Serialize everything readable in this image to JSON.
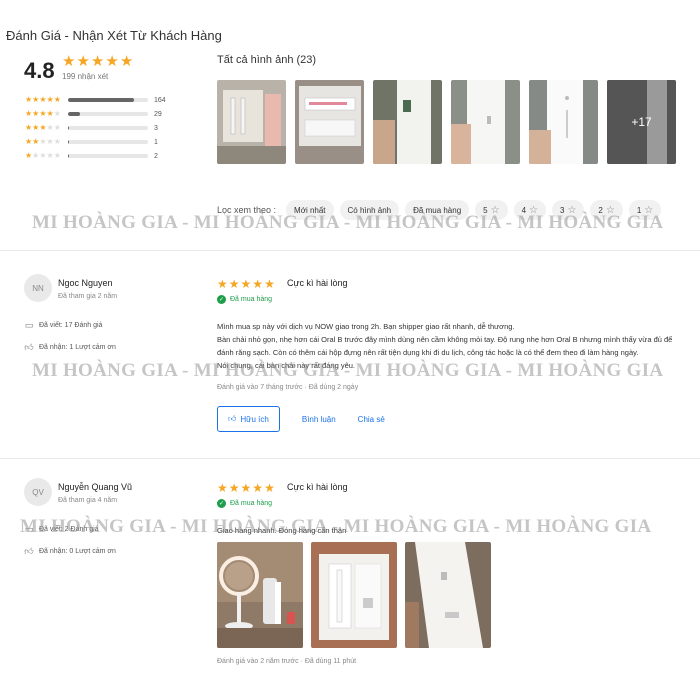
{
  "header": {
    "title": "Đánh Giá - Nhận Xét Từ Khách Hàng"
  },
  "summary": {
    "score": "4.8",
    "review_count": "199 nhận xét",
    "distribution": [
      {
        "stars": 5,
        "count": "164",
        "fraction": 0.824
      },
      {
        "stars": 4,
        "count": "29",
        "fraction": 0.146
      },
      {
        "stars": 3,
        "count": "3",
        "fraction": 0.015
      },
      {
        "stars": 2,
        "count": "1",
        "fraction": 0.005
      },
      {
        "stars": 1,
        "count": "2",
        "fraction": 0.01
      }
    ]
  },
  "gallery": {
    "title": "Tất cả hình ảnh (23)",
    "more_label": "+17"
  },
  "filters": {
    "label": "Lọc xem theo :",
    "chips": [
      "Mới nhất",
      "Có hình ảnh",
      "Đã mua hàng",
      "5",
      "4",
      "3",
      "2",
      "1"
    ]
  },
  "watermark": "MI HOÀNG GIA - MI HOÀNG GIA - MI HOÀNG GIA - MI HOÀNG GIA",
  "reviews": [
    {
      "avatar": "NN",
      "name": "Ngoc Nguyen",
      "joined": "Đã tham gia 2 năm",
      "written": "Đã viết: 17 Đánh giá",
      "received": "Đã nhận: 1 Lượt cảm ơn",
      "rating": 5,
      "title": "Cực kì hài lòng",
      "verified": "Đã mua hàng",
      "text": [
        "Mình mua sp này với dịch vụ NOW giao trong 2h. Bạn shipper giao rất nhanh, dễ thương.",
        "Bàn chải nhỏ gọn, nhẹ hơn cái Oral B trước đây mình dùng nên cầm không mỏi tay. Độ rung nhẹ hơn Oral B nhưng mình thấy vừa đủ để đánh răng sạch. Còn có thêm cái hộp đựng nên rất tiện dụng khi đi du lịch, công tác hoặc là có thể đem theo đi làm hàng ngày.",
        "Nói chung, cái bàn chải này rất đáng yêu."
      ],
      "meta": "Đánh giá vào 7 tháng trước · Đã dùng 2 ngày",
      "helpful": "Hữu ích",
      "comment": "Bình luận",
      "share": "Chia sẻ"
    },
    {
      "avatar": "QV",
      "name": "Nguyễn Quang Vũ",
      "joined": "Đã tham gia 4 năm",
      "written": "Đã viết: 2 Đánh giá",
      "received": "Đã nhận: 0 Lượt cảm ơn",
      "rating": 5,
      "title": "Cực kì hài lòng",
      "verified": "Đã mua hàng",
      "text": [
        "Giao hàng nhanh. Đóng hàng cẩn thận"
      ],
      "meta": "Đánh giá vào 2 năm trước · Đã dùng 11 phút"
    }
  ],
  "colors": {
    "star": "#f5a623",
    "accent": "#1a73e8",
    "verified": "#1e9e4a"
  }
}
